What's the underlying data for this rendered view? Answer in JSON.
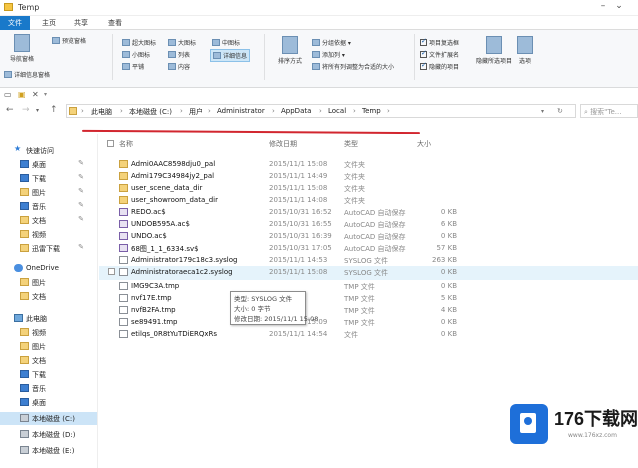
{
  "window": {
    "title": "Temp"
  },
  "tabs": [
    "文件",
    "主页",
    "共享",
    "查看"
  ],
  "ribbon": {
    "nav_pane": "导航窗格",
    "preview_pane": "预览窗格",
    "details_pane": "详细信息窗格",
    "layout": [
      "超大图标",
      "大图标",
      "中图标",
      "小图标",
      "列表",
      "详细信息",
      "平铺",
      "内容"
    ],
    "sort": "排序方式",
    "group": "分组依据",
    "add_columns": "添加列",
    "fit_columns": "将所有列调整为合适的大小",
    "item_checkbox": "项目复选框",
    "file_extensions": "文件扩展名",
    "hidden_items": "隐藏的项目",
    "hide_selected": "隐藏所选项目",
    "options": "选项"
  },
  "address": {
    "crumbs": [
      "此电脑",
      "本地磁盘 (C:)",
      "用户",
      "Administrator",
      "AppData",
      "Local",
      "Temp"
    ],
    "search_placeholder": "搜索\"Te..."
  },
  "sidebar": {
    "items": [
      {
        "label": "快速访问",
        "icon": "star-icon"
      },
      {
        "label": "桌面",
        "icon": "desktop-icon",
        "pinned": true
      },
      {
        "label": "下载",
        "icon": "download-icon",
        "pinned": true
      },
      {
        "label": "图片",
        "icon": "pictures-icon",
        "pinned": true
      },
      {
        "label": "音乐",
        "icon": "music-icon",
        "pinned": true
      },
      {
        "label": "文档",
        "icon": "documents-icon",
        "pinned": true
      },
      {
        "label": "视频",
        "icon": "videos-icon"
      },
      {
        "label": "迅雷下载",
        "icon": "folder-icon",
        "pinned": true
      },
      {
        "label": "OneDrive",
        "icon": "onedrive-icon"
      },
      {
        "label": "图片",
        "icon": "folder-icon"
      },
      {
        "label": "文档",
        "icon": "folder-icon"
      },
      {
        "label": "此电脑",
        "icon": "this-pc-icon"
      },
      {
        "label": "视频",
        "icon": "videos-icon"
      },
      {
        "label": "图片",
        "icon": "pictures-icon"
      },
      {
        "label": "文档",
        "icon": "documents-icon"
      },
      {
        "label": "下载",
        "icon": "download-icon"
      },
      {
        "label": "音乐",
        "icon": "music-icon"
      },
      {
        "label": "桌面",
        "icon": "desktop-icon"
      },
      {
        "label": "本地磁盘 (C:)",
        "icon": "drive-icon",
        "selected": true
      },
      {
        "label": "本地磁盘 (D:)",
        "icon": "drive-icon"
      },
      {
        "label": "本地磁盘 (E:)",
        "icon": "drive-icon"
      }
    ]
  },
  "columns": {
    "name": "名称",
    "date": "修改日期",
    "type": "类型",
    "size": "大小"
  },
  "files": [
    {
      "name": "Admi0AAC8598dju0_pal",
      "date": "2015/11/1 15:08",
      "type": "文件夹",
      "size": "",
      "icon": "folder-icon"
    },
    {
      "name": "Admi179C34984jy2_pal",
      "date": "2015/11/1 14:49",
      "type": "文件夹",
      "size": "",
      "icon": "folder-icon"
    },
    {
      "name": "user_scene_data_dir",
      "date": "2015/11/1 15:08",
      "type": "文件夹",
      "size": "",
      "icon": "folder-icon"
    },
    {
      "name": "user_showroom_data_dir",
      "date": "2015/11/1 14:08",
      "type": "文件夹",
      "size": "",
      "icon": "folder-icon"
    },
    {
      "name": "REDO.ac$",
      "date": "2015/10/31 16:52",
      "type": "AutoCAD 自动保存",
      "size": "0 KB",
      "icon": "autocad-icon"
    },
    {
      "name": "UNDOB595A.ac$",
      "date": "2015/10/31 16:55",
      "type": "AutoCAD 自动保存",
      "size": "6 KB",
      "icon": "autocad-icon"
    },
    {
      "name": "UNDO.ac$",
      "date": "2015/10/31 16:39",
      "type": "AutoCAD 自动保存",
      "size": "0 KB",
      "icon": "autocad-icon"
    },
    {
      "name": "68图_1_1_6334.sv$",
      "date": "2015/10/31 17:05",
      "type": "AutoCAD 自动保存",
      "size": "57 KB",
      "icon": "autocad-icon"
    },
    {
      "name": "Administrator179c18c3.syslog",
      "date": "2015/11/1 14:53",
      "type": "SYSLOG 文件",
      "size": "263 KB",
      "icon": "document-icon"
    },
    {
      "name": "Administratoraeca1c2.syslog",
      "date": "2015/11/1 15:08",
      "type": "SYSLOG 文件",
      "size": "0 KB",
      "icon": "document-icon",
      "hover": true
    },
    {
      "name": "IMG9C3A.tmp",
      "date": "",
      "type": "TMP 文件",
      "size": "0 KB",
      "icon": "document-icon"
    },
    {
      "name": "nvf17E.tmp",
      "date": "",
      "type": "TMP 文件",
      "size": "5 KB",
      "icon": "document-icon"
    },
    {
      "name": "nvfB2FA.tmp",
      "date": "",
      "type": "TMP 文件",
      "size": "4 KB",
      "icon": "document-icon"
    },
    {
      "name": "se89491.tmp",
      "date": "2015/11/1 15:09",
      "type": "TMP 文件",
      "size": "0 KB",
      "icon": "document-icon"
    },
    {
      "name": "etilqs_0R8tYuTDiERQxRs",
      "date": "2015/11/1 14:54",
      "type": "文件",
      "size": "0 KB",
      "icon": "document-icon"
    }
  ],
  "tooltip": {
    "type": "类型: SYSLOG 文件",
    "size": "大小: 0 字节",
    "modified": "修改日期: 2015/11/1 15:08"
  },
  "watermark": {
    "name": "176下载网",
    "url": "www.176xz.com"
  }
}
